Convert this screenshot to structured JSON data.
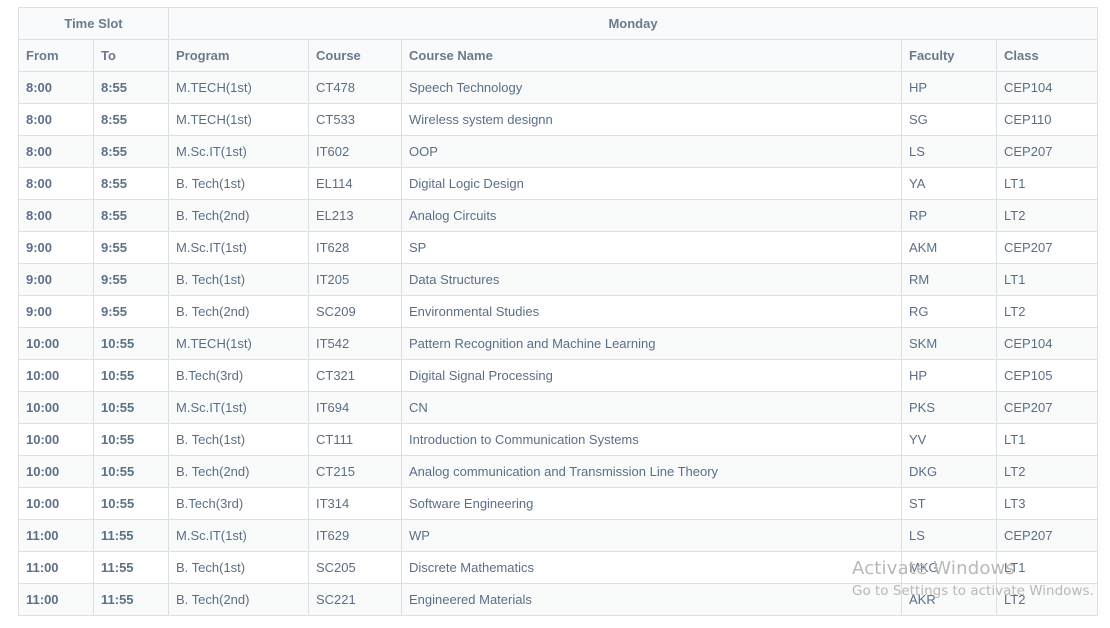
{
  "timetable": {
    "group_headers": {
      "time_slot": "Time Slot",
      "day": "Monday"
    },
    "columns": [
      "From",
      "To",
      "Program",
      "Course",
      "Course Name",
      "Faculty",
      "Class"
    ],
    "rows": [
      [
        "8:00",
        "8:55",
        "M.TECH(1st)",
        "CT478",
        "Speech Technology",
        "HP",
        "CEP104"
      ],
      [
        "8:00",
        "8:55",
        "M.TECH(1st)",
        "CT533",
        "Wireless system designn",
        "SG",
        "CEP110"
      ],
      [
        "8:00",
        "8:55",
        "M.Sc.IT(1st)",
        "IT602",
        "OOP",
        "LS",
        "CEP207"
      ],
      [
        "8:00",
        "8:55",
        "B. Tech(1st)",
        "EL114",
        "Digital Logic Design",
        "YA",
        "LT1"
      ],
      [
        "8:00",
        "8:55",
        "B. Tech(2nd)",
        "EL213",
        "Analog Circuits",
        "RP",
        "LT2"
      ],
      [
        "9:00",
        "9:55",
        "M.Sc.IT(1st)",
        "IT628",
        "SP",
        "AKM",
        "CEP207"
      ],
      [
        "9:00",
        "9:55",
        "B. Tech(1st)",
        "IT205",
        "Data Structures",
        "RM",
        "LT1"
      ],
      [
        "9:00",
        "9:55",
        "B. Tech(2nd)",
        "SC209",
        "Environmental Studies",
        "RG",
        "LT2"
      ],
      [
        "10:00",
        "10:55",
        "M.TECH(1st)",
        "IT542",
        "Pattern Recognition and Machine Learning",
        "SKM",
        "CEP104"
      ],
      [
        "10:00",
        "10:55",
        "B.Tech(3rd)",
        "CT321",
        "Digital Signal Processing",
        "HP",
        "CEP105"
      ],
      [
        "10:00",
        "10:55",
        "M.Sc.IT(1st)",
        "IT694",
        "CN",
        "PKS",
        "CEP207"
      ],
      [
        "10:00",
        "10:55",
        "B. Tech(1st)",
        "CT111",
        "Introduction to Communication Systems",
        "YV",
        "LT1"
      ],
      [
        "10:00",
        "10:55",
        "B. Tech(2nd)",
        "CT215",
        "Analog communication and Transmission Line Theory",
        "DKG",
        "LT2"
      ],
      [
        "10:00",
        "10:55",
        "B.Tech(3rd)",
        "IT314",
        "Software Engineering",
        "ST",
        "LT3"
      ],
      [
        "11:00",
        "11:55",
        "M.Sc.IT(1st)",
        "IT629",
        "WP",
        "LS",
        "CEP207"
      ],
      [
        "11:00",
        "11:55",
        "B. Tech(1st)",
        "SC205",
        "Discrete Mathematics",
        "MKG",
        "LT1"
      ],
      [
        "11:00",
        "11:55",
        "B. Tech(2nd)",
        "SC221",
        "Engineered Materials",
        "AKR",
        "LT2"
      ]
    ]
  },
  "watermark": {
    "line1": "Activate Windows",
    "line2": "Go to Settings to activate Windows."
  }
}
